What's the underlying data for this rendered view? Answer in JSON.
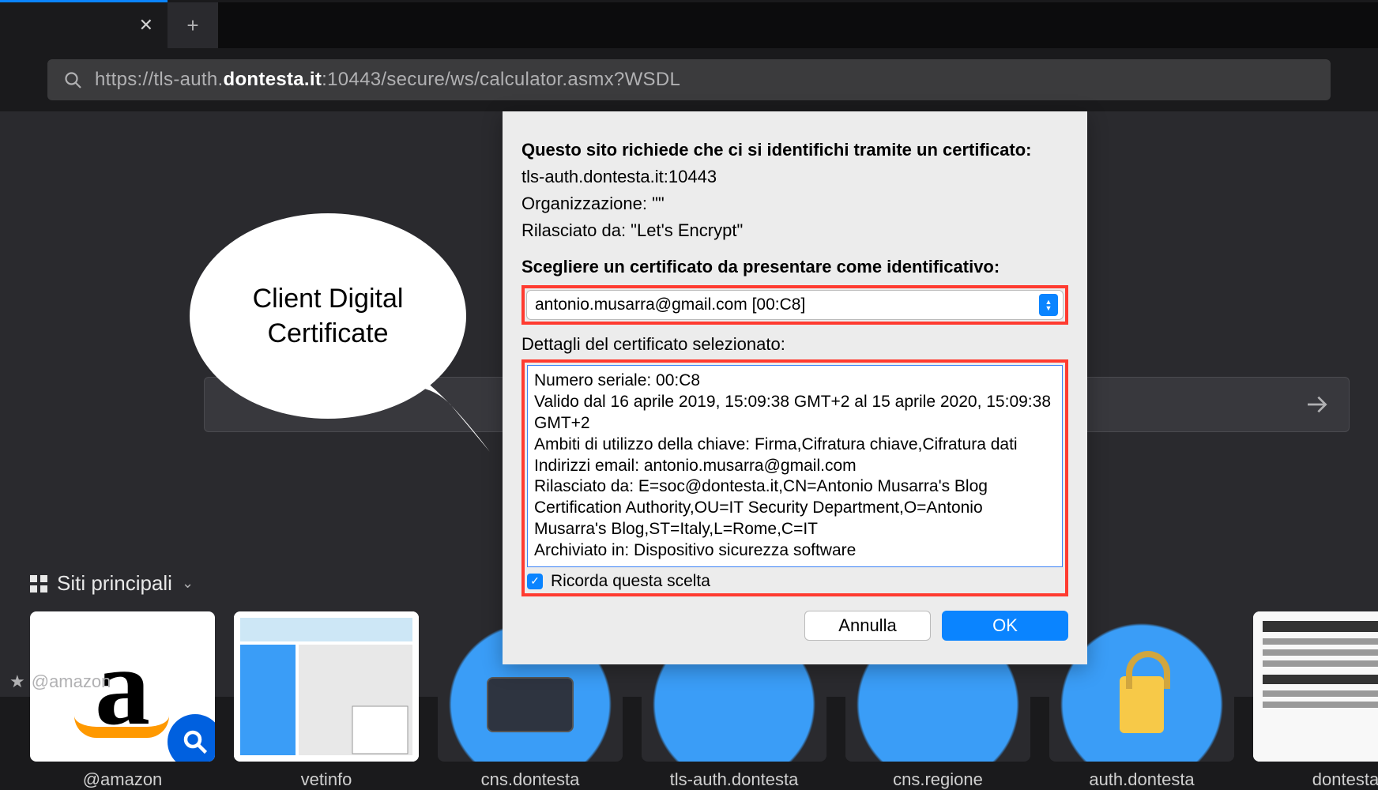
{
  "browser": {
    "url_full": "https://tls-auth.dontesta.it:10443/secure/ws/calculator.asmx?WSDL",
    "url_prefix": "https://tls-auth.",
    "url_bold": "dontesta.it",
    "url_suffix": ":10443/secure/ws/calculator.asmx?WSDL"
  },
  "top_sites": {
    "heading": "Siti principali",
    "tiles": [
      {
        "label": "@amazon"
      },
      {
        "label": "vetinfo"
      },
      {
        "label": "cns.dontesta"
      },
      {
        "label": "tls-auth.dontesta"
      },
      {
        "label": "cns.regione"
      },
      {
        "label": "auth.dontesta"
      },
      {
        "label": "dontesta"
      }
    ]
  },
  "bubble": {
    "line1": "Client Digital",
    "line2": "Certificate"
  },
  "dialog": {
    "heading": "Questo sito richiede che ci si identifichi tramite un certificato:",
    "host": "tls-auth.dontesta.it:10443",
    "org": "Organizzazione: \"\"",
    "issuer": "Rilasciato da: \"Let's Encrypt\"",
    "choose": "Scegliere un certificato da presentare come identificativo:",
    "selected_cert": "antonio.musarra@gmail.com [00:C8]",
    "details_label": "Dettagli del certificato selezionato:",
    "details": {
      "serial": "Numero seriale: 00:C8",
      "validity": "Valido dal 16 aprile 2019, 15:09:38 GMT+2 al 15 aprile 2020, 15:09:38 GMT+2",
      "key_usage": "Ambiti di utilizzo della chiave: Firma,Cifratura chiave,Cifratura dati",
      "emails": "Indirizzi email: antonio.musarra@gmail.com",
      "issued_by": "Rilasciato da: E=soc@dontesta.it,CN=Antonio Musarra's Blog Certification Authority,OU=IT Security Department,O=Antonio Musarra's Blog,ST=Italy,L=Rome,C=IT",
      "stored_in": "Archiviato in: Dispositivo sicurezza software"
    },
    "remember": "Ricorda questa scelta",
    "cancel": "Annulla",
    "ok": "OK"
  }
}
